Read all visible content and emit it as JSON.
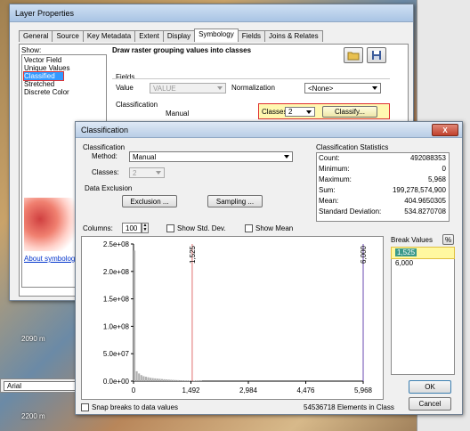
{
  "background": {
    "elevation_label": "2090 m",
    "bottom_label": "2200 m",
    "font_field": "Arial"
  },
  "layer_properties": {
    "title": "Layer Properties",
    "tabs": [
      "General",
      "Source",
      "Key Metadata",
      "Extent",
      "Display",
      "Symbology",
      "Fields",
      "Joins & Relates"
    ],
    "active_tab": "Symbology",
    "show_label": "Show:",
    "show_items": [
      "Vector Field",
      "Unique Values",
      "Classified",
      "Stretched",
      "Discrete Color"
    ],
    "selected_show": "Classified",
    "about_link": "About symbology",
    "heading": "Draw raster grouping values into classes",
    "fields_label": "Fields",
    "value_label": "Value",
    "value_field": "VALUE",
    "normalization_label": "Normalization",
    "normalization_value": "<None>",
    "classification_label": "Classification",
    "classification_method": "Manual",
    "classes_label": "Classes",
    "classes_value": "2",
    "classify_button": "Classify..."
  },
  "classification": {
    "title": "Classification",
    "close_symbol": "X",
    "classification_group": "Classification",
    "method_label": "Method:",
    "method_value": "Manual",
    "classes_label": "Classes:",
    "classes_value": "2",
    "data_exclusion_label": "Data Exclusion",
    "exclusion_button": "Exclusion ...",
    "sampling_button": "Sampling ...",
    "stats_title": "Classification Statistics",
    "stats": [
      {
        "label": "Count:",
        "value": "492088353"
      },
      {
        "label": "Minimum:",
        "value": "0"
      },
      {
        "label": "Maximum:",
        "value": "5,968"
      },
      {
        "label": "Sum:",
        "value": "199,278,574,900"
      },
      {
        "label": "Mean:",
        "value": "404.9650305"
      },
      {
        "label": "Standard Deviation:",
        "value": "534.8270708"
      }
    ],
    "columns_label": "Columns:",
    "columns_value": "100",
    "show_std_label": "Show Std. Dev.",
    "show_mean_label": "Show Mean",
    "break_values_label": "Break Values",
    "percent_button": "%",
    "break_values": [
      "1,525",
      "6,000"
    ],
    "selected_break": "1,525",
    "snap_label": "Snap breaks to data values",
    "elements_text": "54536718 Elements in Class",
    "ok_button": "OK",
    "cancel_button": "Cancel"
  },
  "chart_data": {
    "type": "bar",
    "title": "",
    "xlabel": "",
    "ylabel": "",
    "xlim": [
      0,
      5968
    ],
    "ylim": [
      0,
      250000000
    ],
    "x_ticks": [
      "0",
      "1,492",
      "2,984",
      "4,476",
      "5,968"
    ],
    "x_tick_values": [
      0,
      1492,
      2984,
      4476,
      5968
    ],
    "y_ticks": [
      "0.0e+00",
      "5.0e+07",
      "1.0e+08",
      "1.5e+08",
      "2.0e+08",
      "2.5e+08"
    ],
    "y_tick_values": [
      0,
      50000000,
      100000000,
      150000000,
      200000000,
      250000000
    ],
    "break_lines": [
      {
        "label": "1,525",
        "value": 1525,
        "color": "#e07070"
      },
      {
        "label": "6,000",
        "value": 5968,
        "color": "#6a4ab0"
      }
    ],
    "bin_width": 59.68,
    "histogram": [
      238000000,
      18000000,
      14000000,
      11000000,
      9000000,
      8000000,
      7000000,
      6000000,
      5500000,
      5000000,
      4600000,
      4200000,
      3800000,
      3400000,
      3100000,
      2800000,
      2500000,
      2200000,
      2000000,
      1800000,
      1600000,
      1400000,
      1200000,
      1100000,
      1000000,
      900000,
      800000,
      700000,
      600000,
      500000
    ],
    "grid": false,
    "legend": "none"
  }
}
